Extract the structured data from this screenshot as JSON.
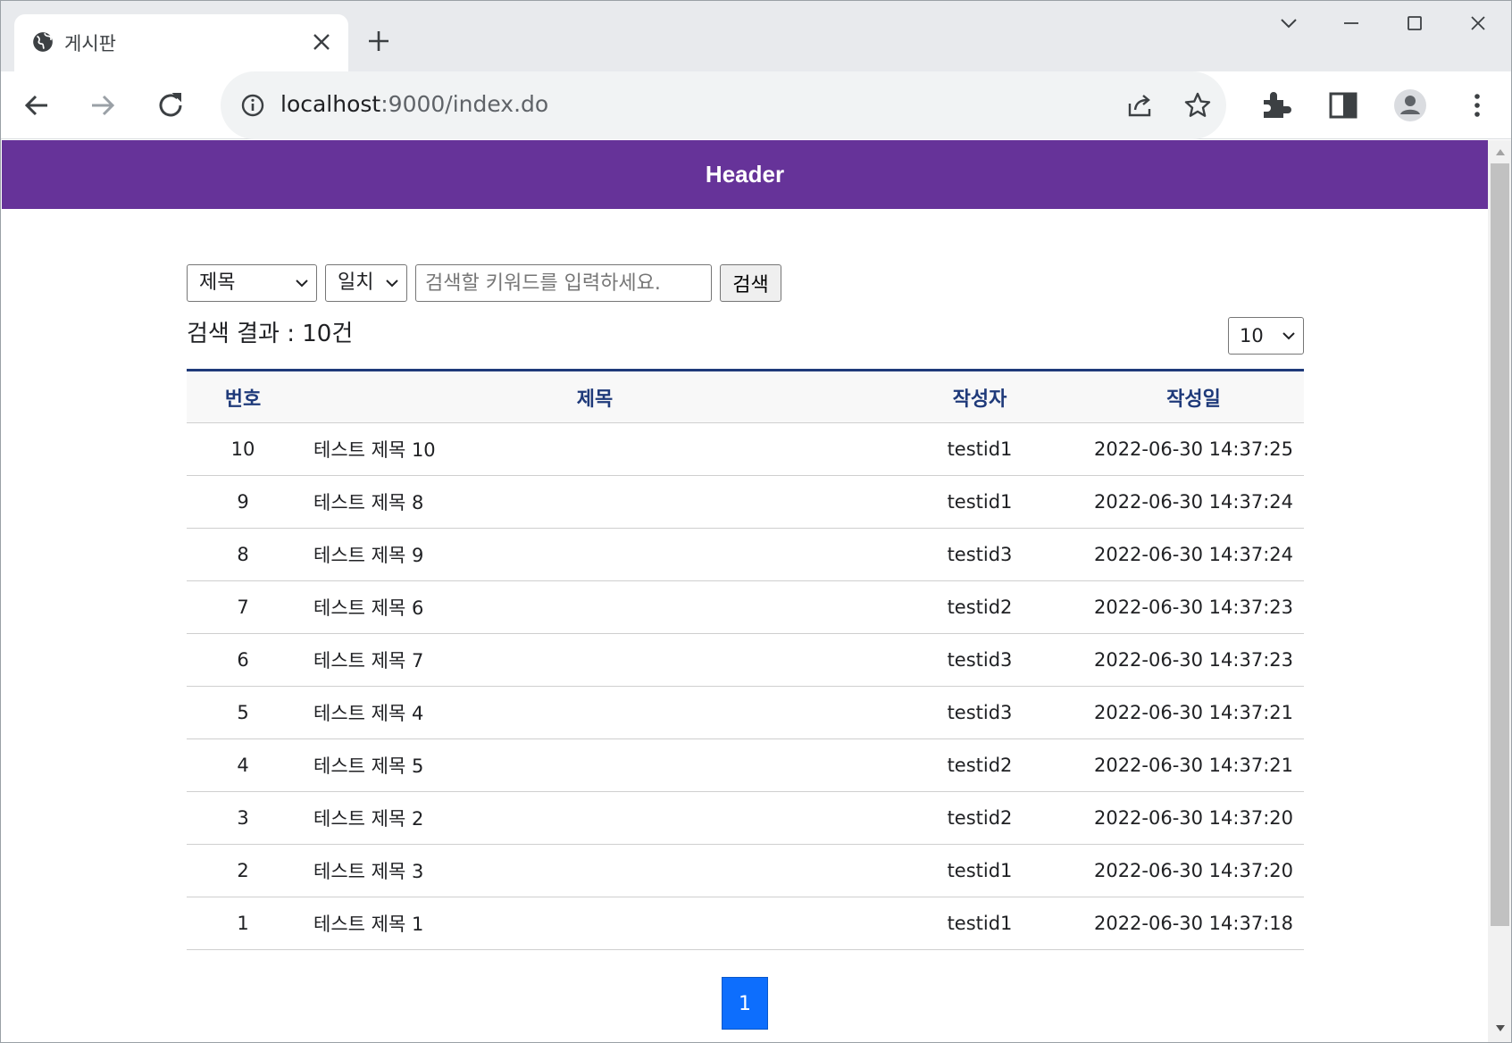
{
  "browser": {
    "tab_title": "게시판",
    "url_host": "localhost",
    "url_rest": ":9000/index.do"
  },
  "page": {
    "header_title": "Header",
    "search": {
      "field_selected": "제목",
      "match_selected": "일치",
      "keyword_placeholder": "검색할 키워드를 입력하세요.",
      "keyword_value": "",
      "button_label": "검색"
    },
    "result_text": "검색 결과 : 10건",
    "page_size_selected": "10",
    "table": {
      "headers": {
        "no": "번호",
        "title": "제목",
        "writer": "작성자",
        "date": "작성일"
      },
      "rows": [
        {
          "no": "10",
          "title": "테스트 제목 10",
          "writer": "testid1",
          "date": "2022-06-30 14:37:25"
        },
        {
          "no": "9",
          "title": "테스트 제목 8",
          "writer": "testid1",
          "date": "2022-06-30 14:37:24"
        },
        {
          "no": "8",
          "title": "테스트 제목 9",
          "writer": "testid3",
          "date": "2022-06-30 14:37:24"
        },
        {
          "no": "7",
          "title": "테스트 제목 6",
          "writer": "testid2",
          "date": "2022-06-30 14:37:23"
        },
        {
          "no": "6",
          "title": "테스트 제목 7",
          "writer": "testid3",
          "date": "2022-06-30 14:37:23"
        },
        {
          "no": "5",
          "title": "테스트 제목 4",
          "writer": "testid3",
          "date": "2022-06-30 14:37:21"
        },
        {
          "no": "4",
          "title": "테스트 제목 5",
          "writer": "testid2",
          "date": "2022-06-30 14:37:21"
        },
        {
          "no": "3",
          "title": "테스트 제목 2",
          "writer": "testid2",
          "date": "2022-06-30 14:37:20"
        },
        {
          "no": "2",
          "title": "테스트 제목 3",
          "writer": "testid1",
          "date": "2022-06-30 14:37:20"
        },
        {
          "no": "1",
          "title": "테스트 제목 1",
          "writer": "testid1",
          "date": "2022-06-30 14:37:18"
        }
      ]
    },
    "pagination": {
      "current_page": "1"
    }
  },
  "colors": {
    "header_bg": "#663399",
    "table_accent": "#1f3a7a",
    "pager_active": "#0d6efd"
  },
  "icons": [
    "globe-icon",
    "close-icon",
    "plus-icon",
    "chevron-down-icon",
    "minimize-icon",
    "maximize-icon",
    "back-icon",
    "forward-icon",
    "reload-icon",
    "info-icon",
    "share-icon",
    "star-icon",
    "extensions-icon",
    "side-panel-icon",
    "profile-icon",
    "menu-icon"
  ]
}
